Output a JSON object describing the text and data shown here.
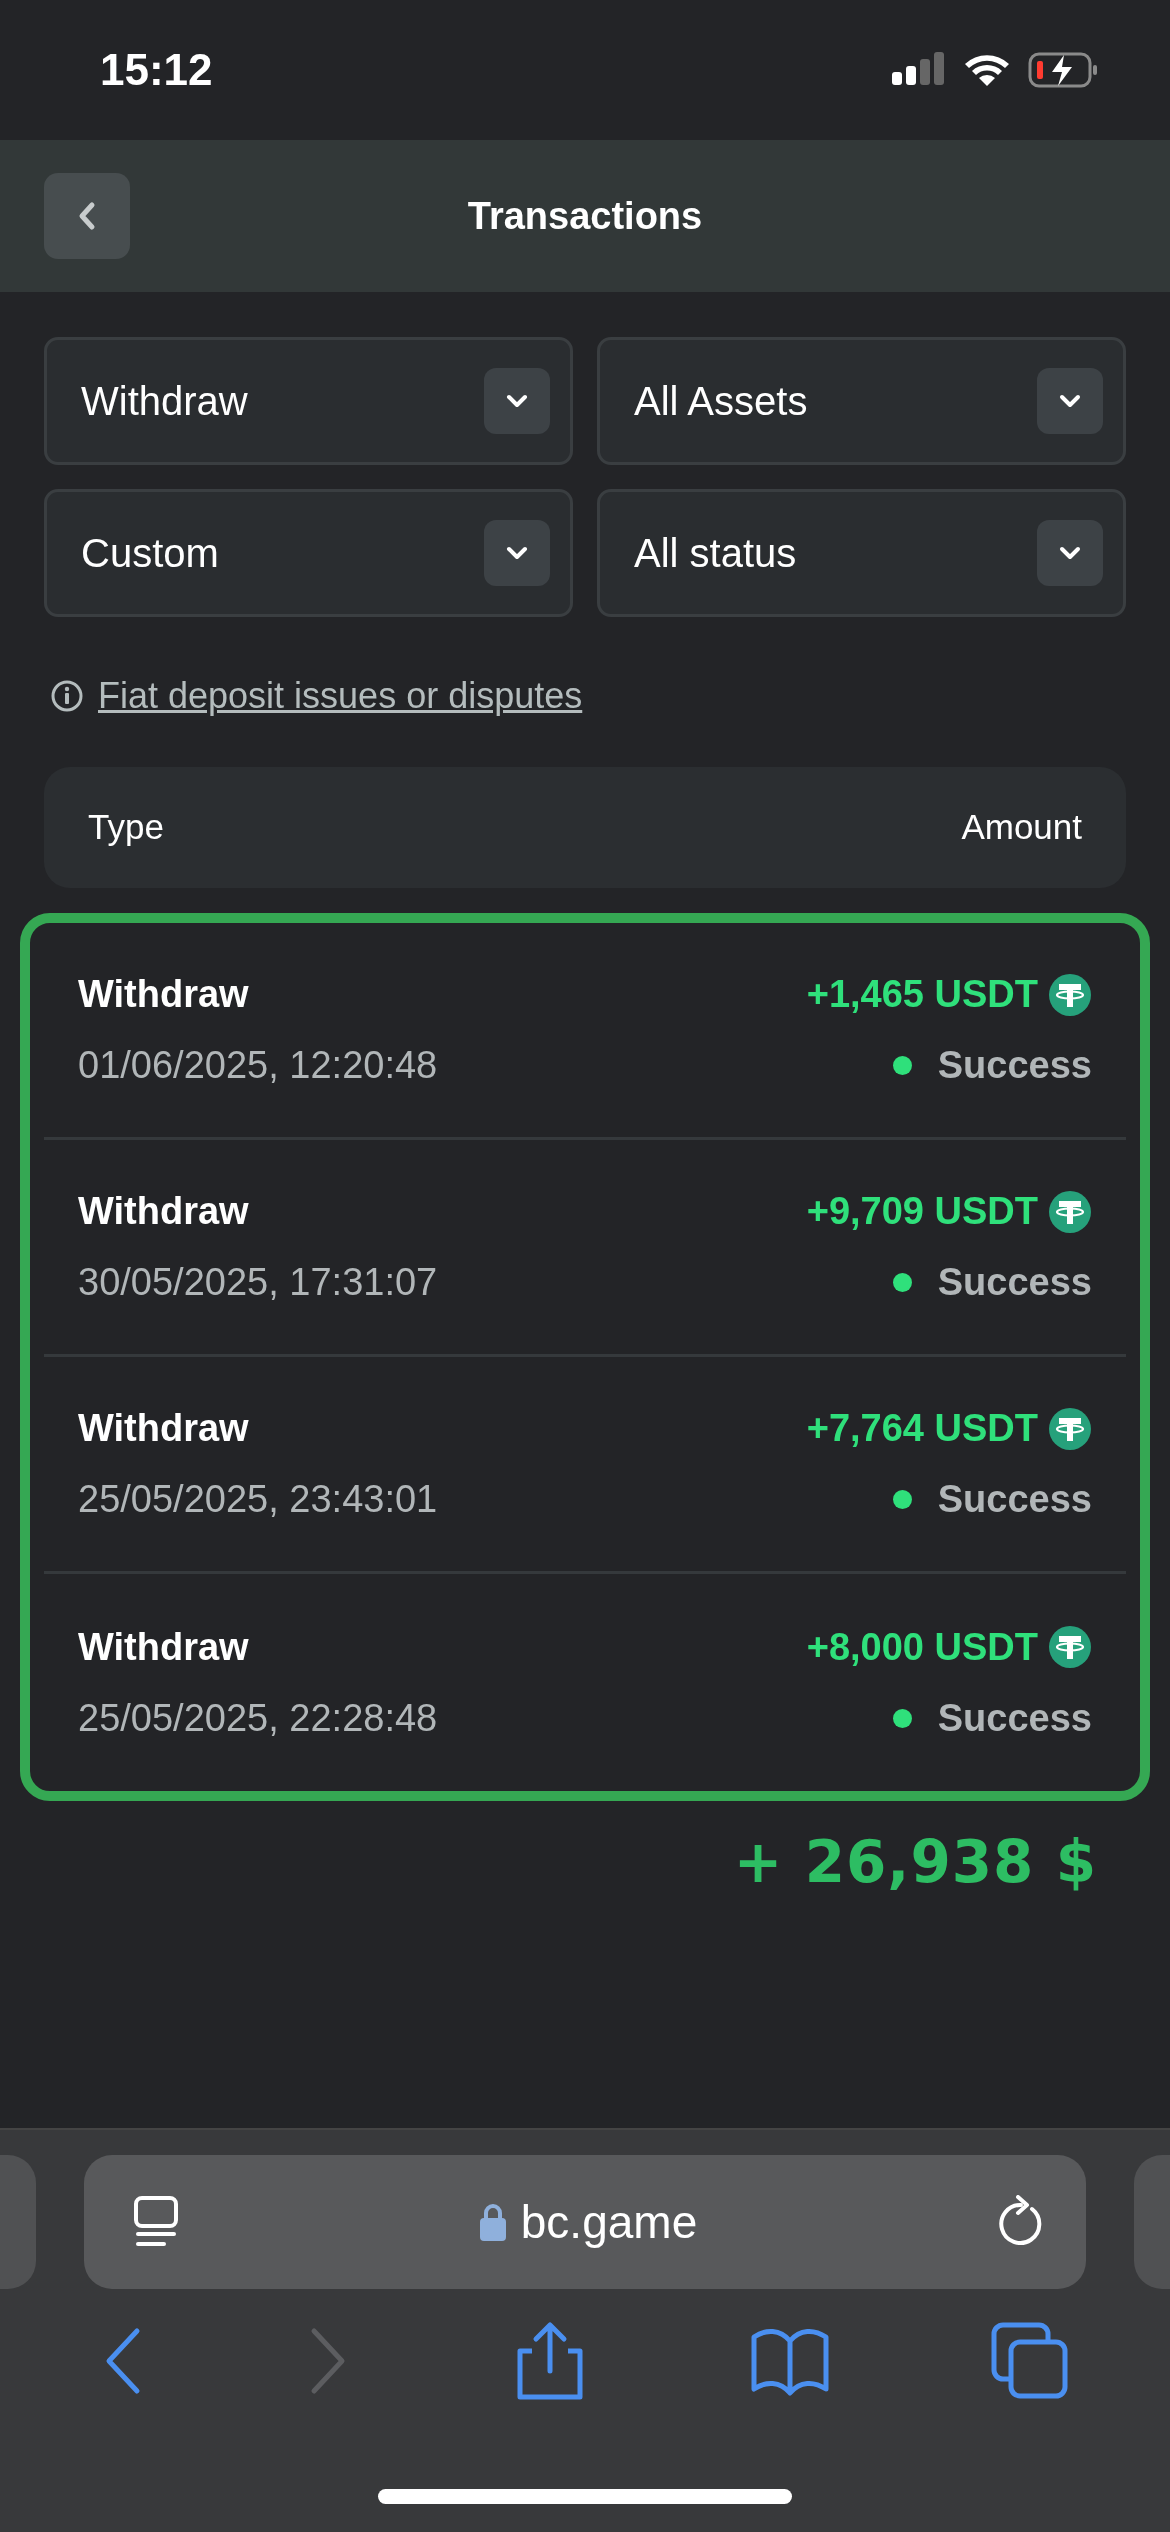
{
  "status_bar": {
    "time": "15:12"
  },
  "header": {
    "title": "Transactions"
  },
  "filters": [
    {
      "value": "Withdraw"
    },
    {
      "value": "All Assets"
    },
    {
      "value": "Custom"
    },
    {
      "value": "All status"
    }
  ],
  "info_link": "Fiat deposit issues or disputes",
  "table": {
    "columns": [
      "Type",
      "Amount"
    ],
    "rows": [
      {
        "type": "Withdraw",
        "date": "01/06/2025, 12:20:48",
        "amount": "+1,465 USDT",
        "status": "Success"
      },
      {
        "type": "Withdraw",
        "date": "30/05/2025, 17:31:07",
        "amount": "+9,709 USDT",
        "status": "Success"
      },
      {
        "type": "Withdraw",
        "date": "25/05/2025, 23:43:01",
        "amount": "+7,764 USDT",
        "status": "Success"
      },
      {
        "type": "Withdraw",
        "date": "25/05/2025, 22:28:48",
        "amount": "+8,000 USDT",
        "status": "Success"
      }
    ]
  },
  "total": "+ 26,938 $",
  "browser": {
    "url": "bc.game",
    "forward_disabled": true
  }
}
